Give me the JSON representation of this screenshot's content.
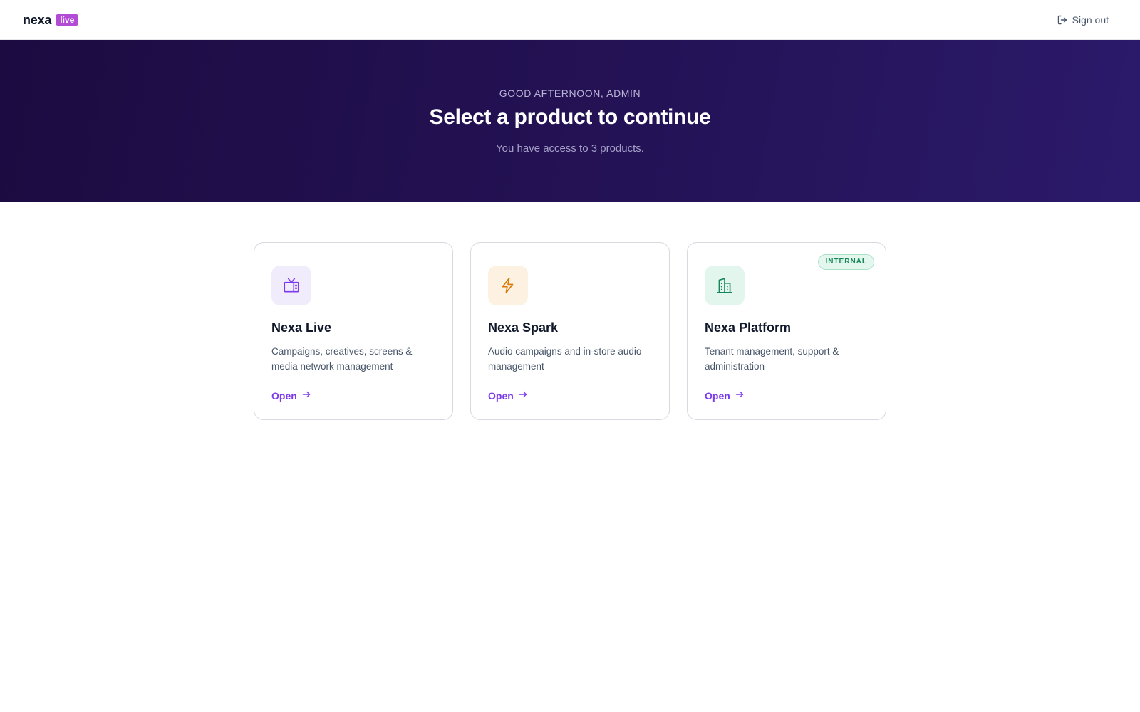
{
  "header": {
    "brand": "nexa",
    "brand_badge": "live",
    "sign_out_label": "Sign out"
  },
  "hero": {
    "greeting": "GOOD AFTERNOON, ADMIN",
    "title": "Select a product to continue",
    "subtitle": "You have access to 3 products."
  },
  "products": [
    {
      "icon": "tv-icon",
      "title": "Nexa Live",
      "description": "Campaigns, creatives, screens & media network management",
      "open_label": "Open",
      "icon_bg": "#f1ecfc",
      "icon_color": "#7c3aed"
    },
    {
      "icon": "lightning-icon",
      "title": "Nexa Spark",
      "description": "Audio campaigns and in-store audio management",
      "open_label": "Open",
      "icon_bg": "#fdf2e2",
      "icon_color": "#d97706"
    },
    {
      "icon": "building-icon",
      "title": "Nexa Platform",
      "description": "Tenant management, support & administration",
      "open_label": "Open",
      "badge": "INTERNAL",
      "icon_bg": "#e3f6ee",
      "icon_color": "#15885a"
    }
  ],
  "colors": {
    "accent": "#7c3aed",
    "brand_badge": "#b44bd6",
    "hero_start": "#1c0b41",
    "hero_end": "#2b1a6a"
  }
}
